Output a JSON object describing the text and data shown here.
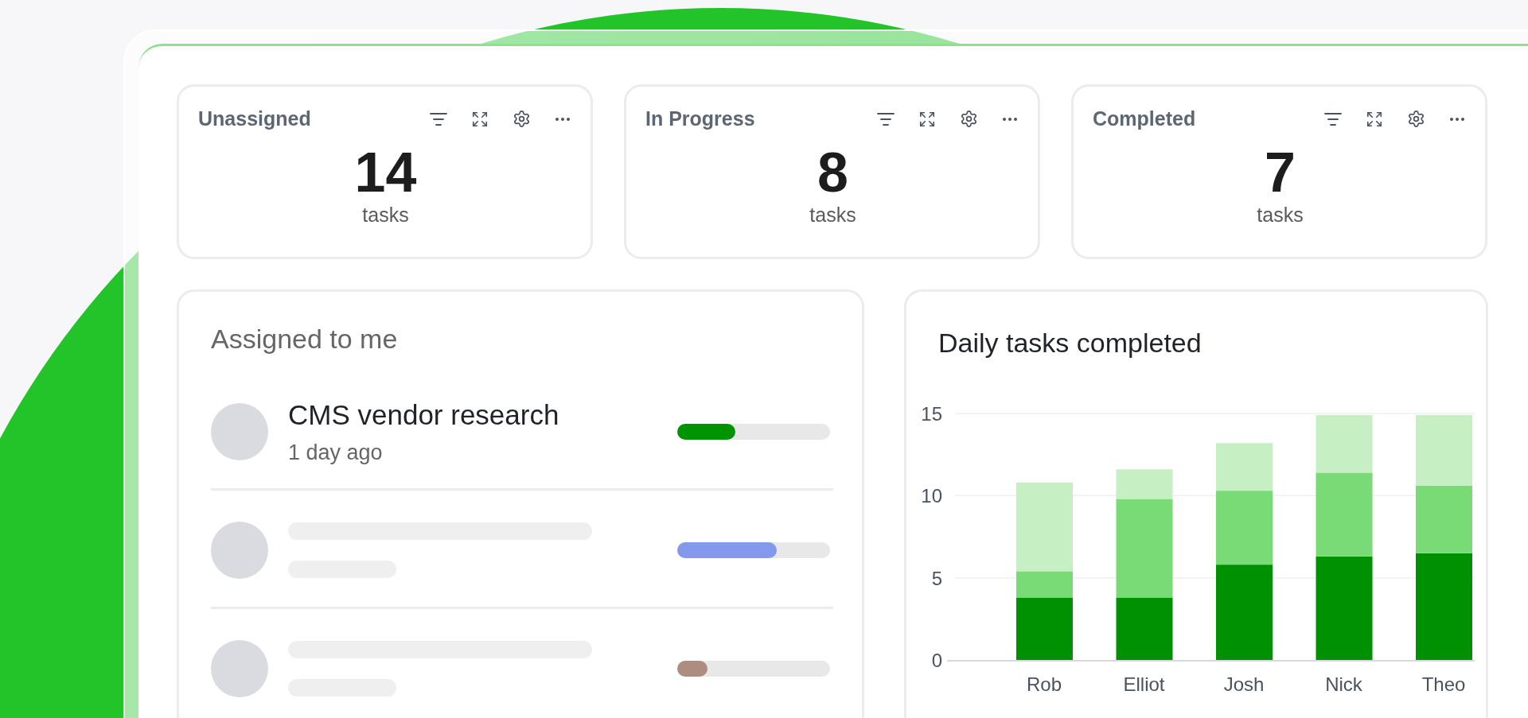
{
  "stat_cards": [
    {
      "title": "Unassigned",
      "value": "14",
      "unit": "tasks"
    },
    {
      "title": "In Progress",
      "value": "8",
      "unit": "tasks"
    },
    {
      "title": "Completed",
      "value": "7",
      "unit": "tasks"
    }
  ],
  "assigned": {
    "title": "Assigned to me",
    "tasks": [
      {
        "kind": "task",
        "title": "CMS vendor research",
        "time": "1 day ago",
        "level": 0.38,
        "color": "#009402"
      },
      {
        "kind": "skeleton",
        "level": 0.65,
        "color": "#8299ec"
      },
      {
        "kind": "skeleton",
        "level": 0.2,
        "color": "#ad8d80"
      }
    ]
  },
  "daily_chart": {
    "title": "Daily tasks completed",
    "chart_data": {
      "type": "bar",
      "stacked": true,
      "categories": [
        "Rob",
        "Elliot",
        "Josh",
        "Nick",
        "Theo"
      ],
      "ylim": [
        0,
        15
      ],
      "yticks": [
        0,
        5,
        10,
        15
      ],
      "series": [
        {
          "color": "#009102",
          "values": [
            3.8,
            3.8,
            5.8,
            6.3,
            6.5
          ]
        },
        {
          "color": "#79db76",
          "values": [
            1.6,
            6.0,
            4.5,
            5.1,
            4.1
          ]
        },
        {
          "color": "#c6efc4",
          "values": [
            5.4,
            1.8,
            2.9,
            3.5,
            4.3
          ]
        }
      ]
    }
  }
}
